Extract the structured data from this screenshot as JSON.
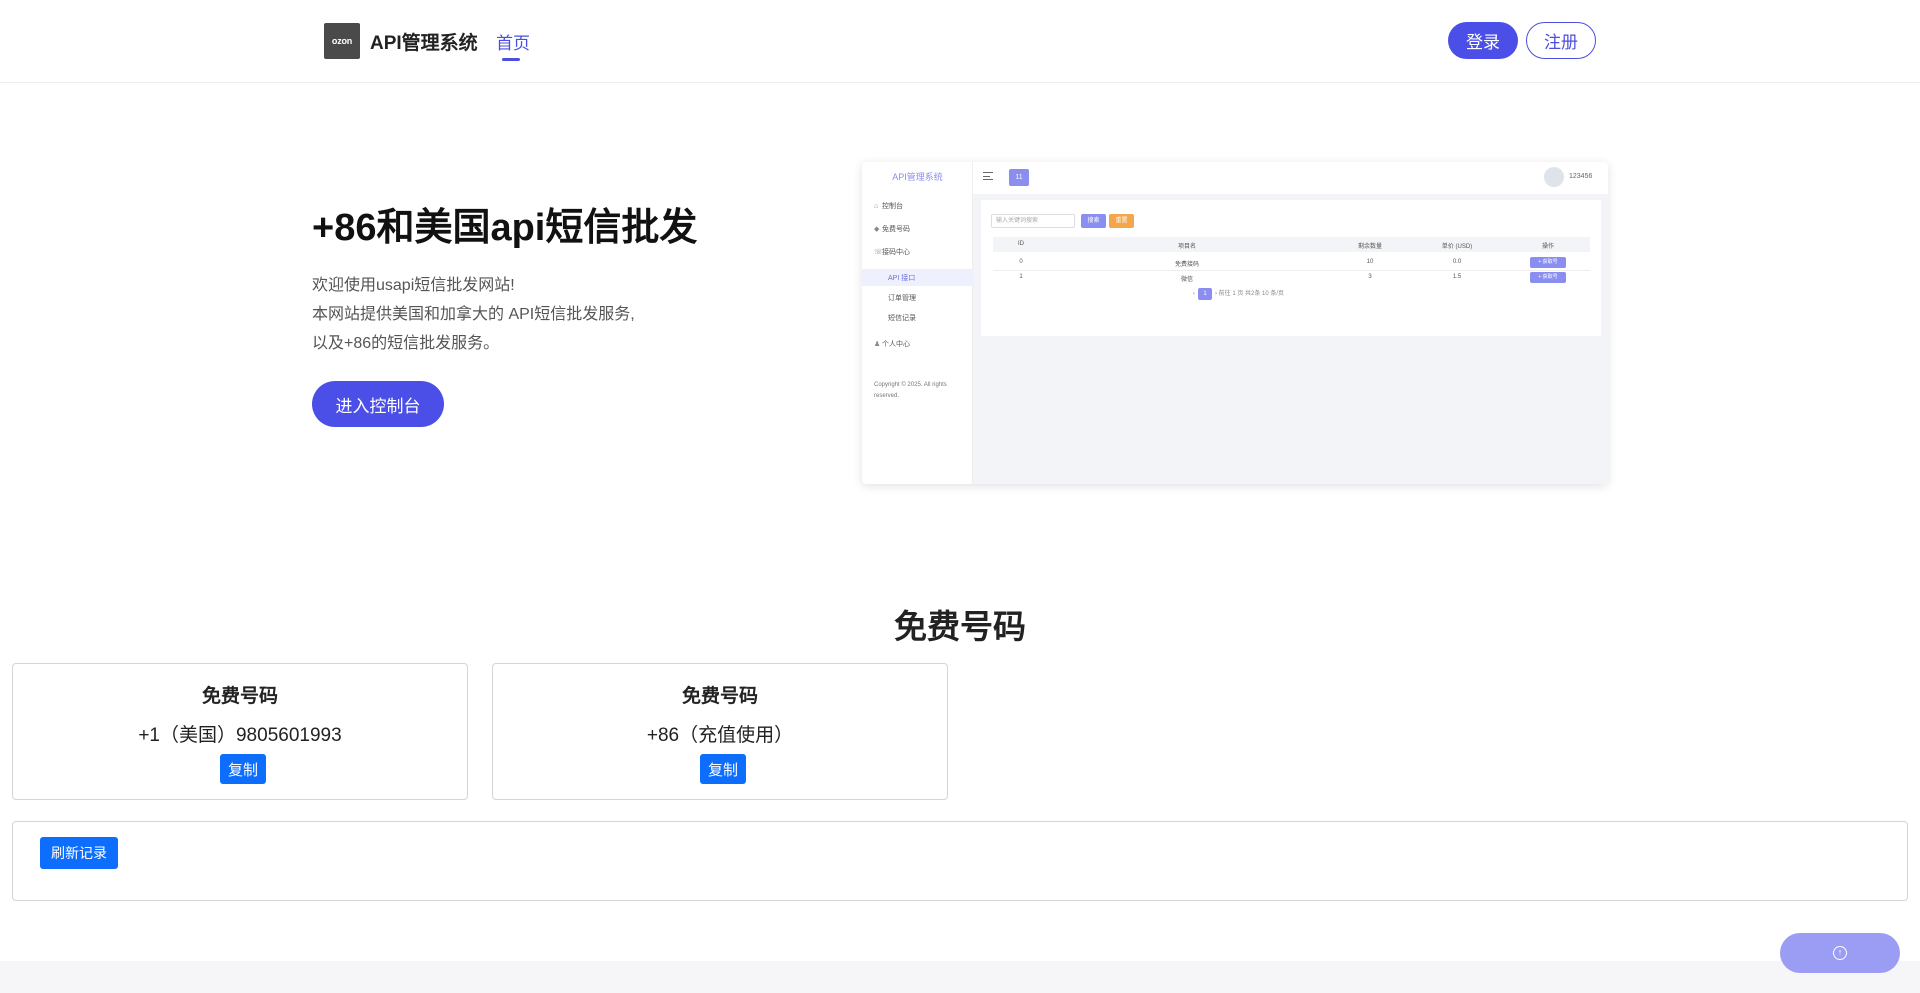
{
  "header": {
    "logo_text": "ozon",
    "app_title": "API管理系统",
    "nav_home": "首页",
    "login_label": "登录",
    "register_label": "注册"
  },
  "hero": {
    "title": "+86和美国api短信批发",
    "line1": "欢迎使用usapi短信批发网站!",
    "line2": "本网站提供美国和加拿大的 API短信批发服务,",
    "line3": "以及+86的短信批发服务。",
    "console_button": "进入控制台"
  },
  "preview": {
    "brand": "API管理系统",
    "menu": [
      "控制台",
      "免费号码",
      "接码中心",
      "API 接口",
      "订单管理",
      "短信记录",
      "个人中心"
    ],
    "tag": "11",
    "user": "123456",
    "search_placeholder": "输入关键词搜索",
    "search_btn": "搜索",
    "reset_btn": "重置",
    "table_headers": [
      "ID",
      "项目名",
      "剩余数量",
      "单价 (USD)",
      "操作"
    ],
    "rows": [
      {
        "id": "0",
        "name": "免费接码",
        "count": "10",
        "price": "0.0",
        "action": "+ 获取号"
      },
      {
        "id": "1",
        "name": "微信",
        "count": "3",
        "price": "1.5",
        "action": "+ 获取号"
      }
    ],
    "pager_text": "前往  1  页   共2条   10 条/页",
    "copyright": "Copyright © 2025. All rights reserved."
  },
  "free_numbers": {
    "section_title": "免费号码",
    "cards": [
      {
        "title": "免费号码",
        "number": "+1（美国）9805601993",
        "copy_label": "复制"
      },
      {
        "title": "免费号码",
        "number": "+86（充值使用）",
        "copy_label": "复制"
      }
    ],
    "refresh_label": "刷新记录"
  },
  "colors": {
    "primary": "#4b4fe8",
    "bootstrap_blue": "#0d6efd",
    "preview_accent": "#8a8ef0"
  },
  "icons": {
    "back_to_top": "arrow-up-circle-icon"
  }
}
